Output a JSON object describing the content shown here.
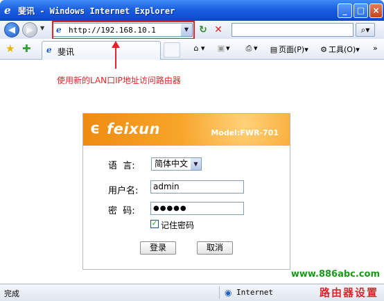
{
  "window": {
    "title": "斐讯 - Windows Internet Explorer",
    "minimize_glyph": "_",
    "maximize_glyph": "□",
    "close_glyph": "×"
  },
  "address_bar": {
    "url": "http://192.168.10.1",
    "highlight_color": "#e0242a"
  },
  "tab": {
    "title": "斐讯"
  },
  "toolbar": {
    "page_label": "页面(P)",
    "tools_label": "工具(O)"
  },
  "annotation": {
    "text": "使用新的LAN口IP地址访问路由器",
    "color": "#e0242a"
  },
  "login": {
    "brand": "feixun",
    "model": "Model:FWR-701",
    "language_label": "语  言:",
    "language_value": "简体中文",
    "username_label": "用户名:",
    "username_value": "admin",
    "password_label": "密  码:",
    "password_value": "●●●●●",
    "remember_label": "记住密码",
    "remember_checked": true,
    "login_button": "登录",
    "cancel_button": "取消",
    "accent_color": "#f29417"
  },
  "watermark": {
    "url": "www.886abc.com",
    "name": "路由器设置"
  },
  "status_bar": {
    "status": "完成",
    "zone": "Internet"
  }
}
